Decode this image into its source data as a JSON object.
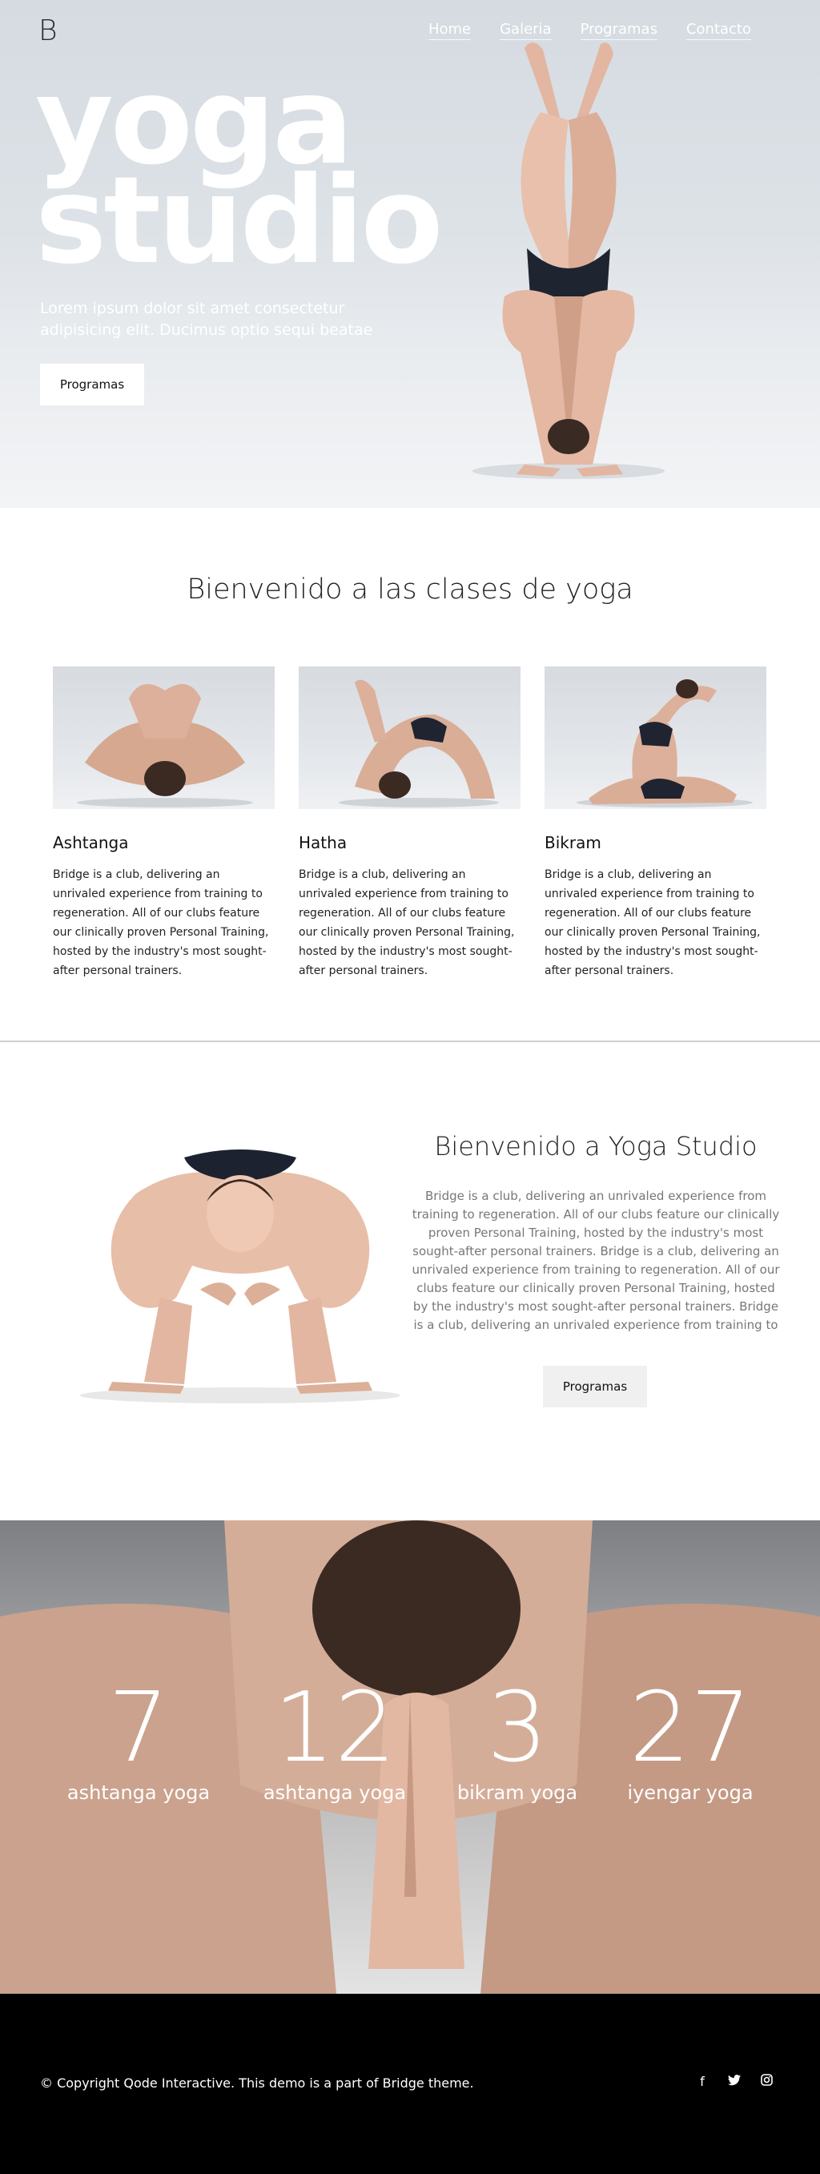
{
  "header": {
    "logo": "B",
    "nav": [
      "Home",
      "Galeria",
      "Programas",
      "Contacto"
    ]
  },
  "hero": {
    "title_line1": "yoga",
    "title_line2": "studio",
    "subtitle": "Lorem ipsum dolor sit amet consectetur adipisicing elit. Ducimus optio sequi beatae",
    "button": "Programas"
  },
  "classes": {
    "title": "Bienvenido a las clases de yoga",
    "cards": [
      {
        "name": "Ashtanga",
        "text": "Bridge is a club, delivering an unrivaled experience from training to regeneration. All of our clubs feature our clinically proven Personal Training, hosted by the industry's most sought-after personal trainers."
      },
      {
        "name": "Hatha",
        "text": "Bridge is a club, delivering an unrivaled experience from training to regeneration. All of our clubs feature our clinically proven Personal Training, hosted by the industry's most sought-after personal trainers."
      },
      {
        "name": "Bikram",
        "text": "Bridge is a club, delivering an unrivaled experience from training to regeneration. All of our clubs feature our clinically proven Personal Training, hosted by the industry's most sought-after personal trainers."
      }
    ]
  },
  "welcome": {
    "title": "Bienvenido a Yoga Studio",
    "text": "Bridge is a club, delivering an unrivaled experience from training to regeneration. All of our clubs feature our clinically proven Personal Training, hosted by the industry's most sought-after personal trainers. Bridge is a club, delivering an unrivaled experience from training to regeneration. All of our clubs feature our clinically proven Personal Training, hosted by the industry's most sought-after personal trainers. Bridge is a club, delivering an unrivaled experience from training to",
    "button": "Programas"
  },
  "stats": [
    {
      "number": "7",
      "label": "ashtanga yoga"
    },
    {
      "number": "12",
      "label": "ashtanga yoga"
    },
    {
      "number": "3",
      "label": "bikram yoga"
    },
    {
      "number": "27",
      "label": "iyengar yoga"
    }
  ],
  "footer": {
    "copyright": "© Copyright Qode Interactive. This demo is a part of Bridge theme.",
    "social": [
      "facebook-icon",
      "twitter-icon",
      "instagram-icon"
    ]
  }
}
